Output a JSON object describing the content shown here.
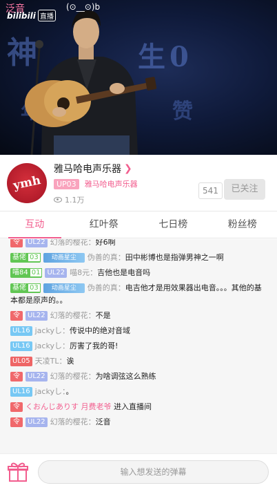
{
  "video": {
    "overlay_text": "泛音",
    "overlay_face": "(⊙__⊙)b",
    "logo_text": "bilibili",
    "live_badge": "直播",
    "bg_text_1": "神",
    "bg_text_2": "生0",
    "bg_text_3": "年",
    "bg_text_4": "赞"
  },
  "streamer": {
    "name": "雅马哈电声乐器",
    "up_badge": "UP03",
    "up_name": "雅马哈电声乐器",
    "views": "1.1万",
    "fans": "541",
    "follow_label": "已关注",
    "avatar_mark": "ymh"
  },
  "tabs": [
    "互动",
    "红叶祭",
    "七日榜",
    "粉丝榜"
  ],
  "chat": [
    {
      "badges": [
        {
          "type": "ico",
          "text": "令"
        },
        {
          "type": "ul22",
          "text": "UL22"
        }
      ],
      "user": "幻落的樱花：",
      "text": "好6啊"
    },
    {
      "badges": [
        {
          "type": "fan",
          "text": "基佬",
          "lv": "03"
        },
        {
          "type": "pic",
          "text": "动画星尘"
        }
      ],
      "user": "伪善的真：",
      "text": "田中彬博也是指弹男神之一啊"
    },
    {
      "badges": [
        {
          "type": "fan",
          "text": "喵84",
          "lv": "01"
        },
        {
          "type": "ul22",
          "text": "UL22"
        }
      ],
      "user": "喵8元：",
      "text": "吉他也是电音吗"
    },
    {
      "badges": [
        {
          "type": "fan",
          "text": "基佬",
          "lv": "03"
        },
        {
          "type": "pic",
          "text": "动画星尘"
        }
      ],
      "user": "伪善的真：",
      "text": "电吉他才是用效果器出电音。。。其他的基本都是原声的。。"
    },
    {
      "badges": [
        {
          "type": "ico",
          "text": "令"
        },
        {
          "type": "ul22",
          "text": "UL22"
        }
      ],
      "user": "幻落的樱花：",
      "text": "不是"
    },
    {
      "badges": [
        {
          "type": "ul16",
          "text": "UL16"
        }
      ],
      "user": "jackyし：",
      "text": "传说中的绝对音域"
    },
    {
      "badges": [
        {
          "type": "ul16",
          "text": "UL16"
        }
      ],
      "user": "jackyし：",
      "text": "厉害了我的哥!"
    },
    {
      "badges": [
        {
          "type": "ul05",
          "text": "UL05"
        }
      ],
      "user": "天凌TL：",
      "text": "诶"
    },
    {
      "badges": [
        {
          "type": "ico",
          "text": "令"
        },
        {
          "type": "ul22",
          "text": "UL22"
        }
      ],
      "user": "幻落的樱花：",
      "text": "为啥调弦这么熟练"
    },
    {
      "badges": [
        {
          "type": "ul16",
          "text": "UL16"
        }
      ],
      "user": "jackyし：",
      "text": "。"
    },
    {
      "badges": [
        {
          "type": "ico",
          "text": "令"
        }
      ],
      "user_pink": "くおんじありす 月费老爷",
      "text": "进入直播间",
      "system": true
    },
    {
      "badges": [
        {
          "type": "ico",
          "text": "令"
        },
        {
          "type": "ul22",
          "text": "UL22"
        }
      ],
      "user": "幻落的樱花：",
      "text": "泛音"
    }
  ],
  "bottom": {
    "input_placeholder": "输入想发送的弹幕"
  },
  "colors": {
    "accent": "#f25d8e",
    "video_bg": "#0f1a3a",
    "avatar_red": "#c4202f"
  }
}
